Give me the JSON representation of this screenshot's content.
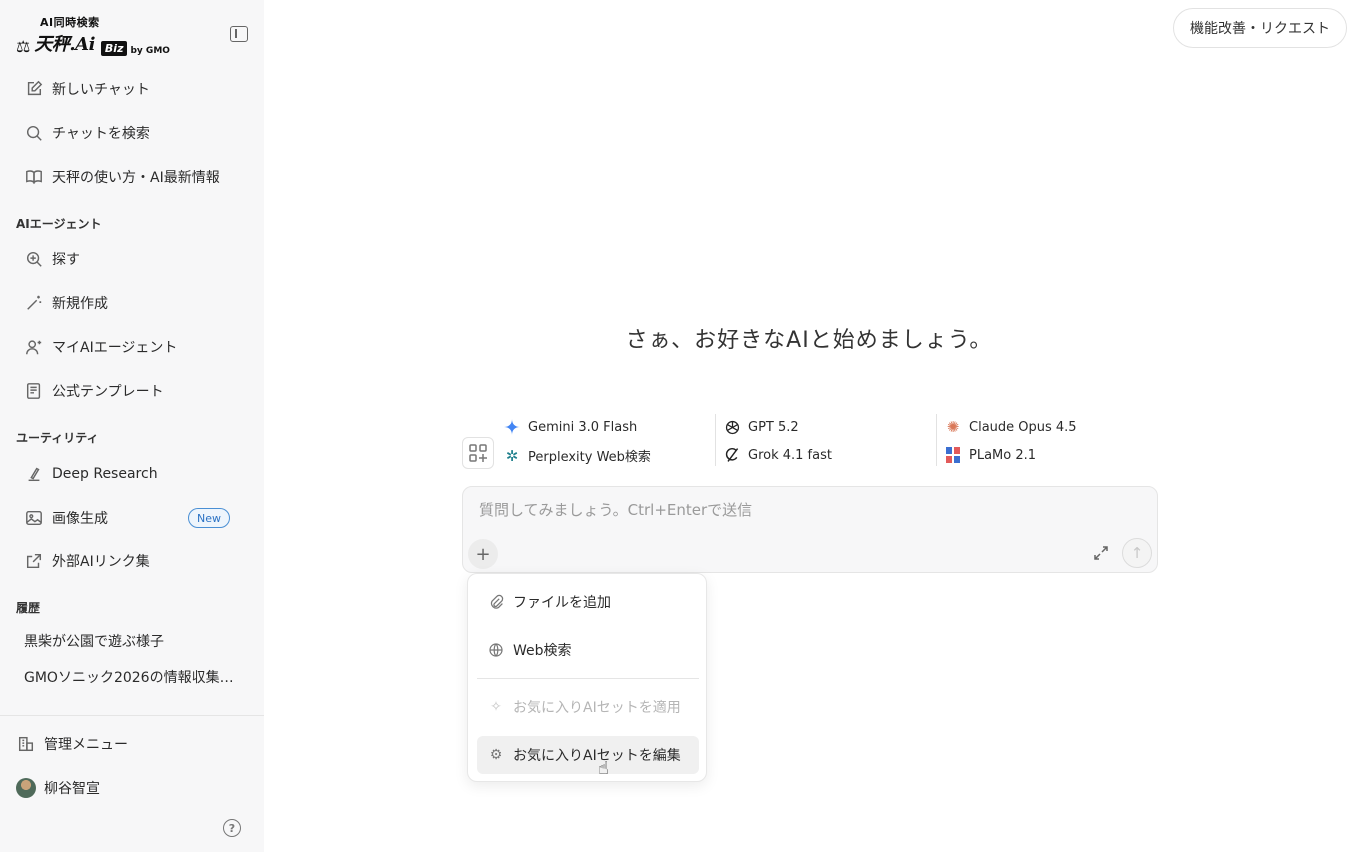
{
  "logo": {
    "small": "AI同時検索",
    "name": "天秤.Ai",
    "biz": "Biz",
    "by": "by GMO"
  },
  "nav": {
    "new_chat": "新しいチャット",
    "search_chat": "チャットを検索",
    "how_to": "天秤の使い方・AI最新情報"
  },
  "agents": {
    "label": "AIエージェント",
    "explore": "探す",
    "create": "新規作成",
    "my_agents": "マイAIエージェント",
    "templates": "公式テンプレート"
  },
  "utility": {
    "label": "ユーティリティ",
    "deep_research": "Deep Research",
    "image_gen": "画像生成",
    "image_gen_badge": "New",
    "external_links": "外部AIリンク集"
  },
  "history": {
    "label": "履歴",
    "items": [
      "黒柴が公園で遊ぶ様子",
      "GMOソニック2026の情報収集方..."
    ]
  },
  "footer": {
    "admin": "管理メニュー",
    "user": "柳谷智宣",
    "help": "?"
  },
  "header": {
    "request_button": "機能改善・リクエスト"
  },
  "hero": "さぁ、お好きなAIと始めましょう。",
  "models": [
    {
      "name": "Gemini 3.0 Flash",
      "color": "#4285f4"
    },
    {
      "name": "GPT 5.2",
      "color": "#222222"
    },
    {
      "name": "Claude Opus 4.5",
      "color": "#d97757"
    },
    {
      "name": "Perplexity Web検索",
      "color": "#20808d"
    },
    {
      "name": "Grok 4.1 fast",
      "color": "#222222"
    },
    {
      "name": "PLaMo 2.1",
      "color": "#3b6fd1"
    }
  ],
  "input": {
    "placeholder": "質問してみましょう。Ctrl+Enterで送信"
  },
  "menu": {
    "add_file": "ファイルを追加",
    "web_search": "Web検索",
    "apply_favorite": "お気に入りAIセットを適用",
    "edit_favorite": "お気に入りAIセットを編集"
  }
}
